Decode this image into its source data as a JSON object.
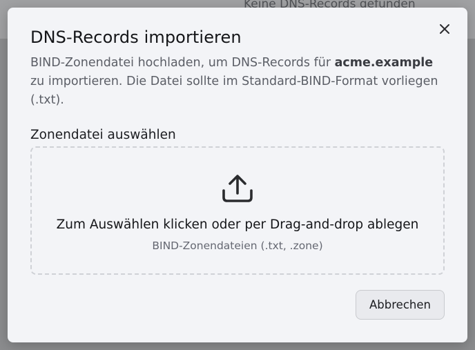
{
  "backdrop": {
    "empty_text": "Keine DNS-Records gefunden"
  },
  "modal": {
    "title": "DNS-Records importieren",
    "description": {
      "before": "BIND-Zonendatei hochladen, um DNS-Records für ",
      "domain": "acme.example",
      "after": " zu importieren. Die Datei sollte im Standard-BIND-Format vorliegen (.txt)."
    },
    "field_label": "Zonendatei auswählen",
    "dropzone": {
      "icon": "upload-icon",
      "title": "Zum Auswählen klicken oder per Drag-and-drop ablegen",
      "subtitle": "BIND-Zonendateien (.txt, .zone)"
    },
    "cancel_label": "Abbrechen",
    "close_icon": "close-icon"
  }
}
